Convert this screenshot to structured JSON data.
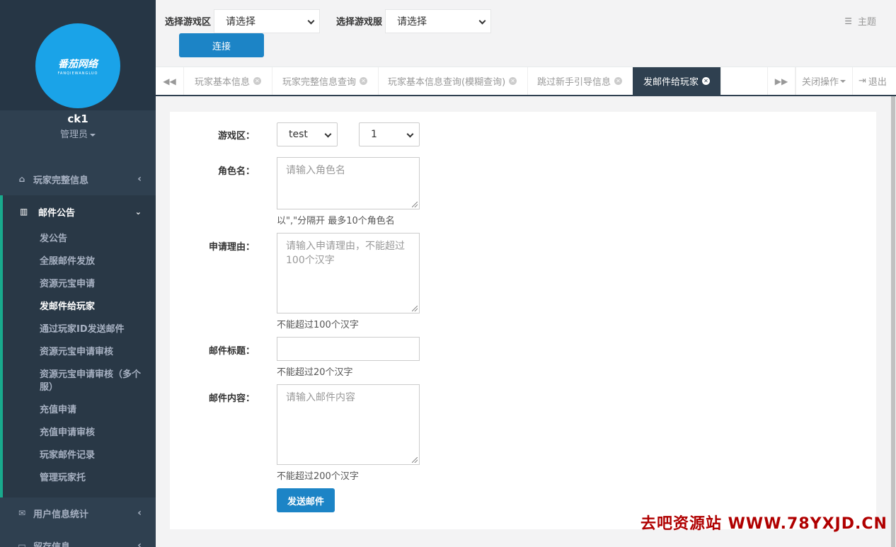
{
  "sidebar": {
    "logo_text": "番茄网络",
    "logo_sub": "FANQIEWANGLUO",
    "username": "ck1",
    "role": "管理员",
    "menu": [
      {
        "label": "玩家完整信息",
        "icon": "home-icon"
      },
      {
        "label": "邮件公告",
        "icon": "bar-chart-icon"
      },
      {
        "label": "用户信息统计",
        "icon": "envelope-icon"
      },
      {
        "label": "留存信息",
        "icon": "monitor-icon"
      }
    ],
    "submenu": [
      "发公告",
      "全服邮件发放",
      "资源元宝申请",
      "发邮件给玩家",
      "通过玩家ID发送邮件",
      "资源元宝申请审核",
      "资源元宝申请审核（多个服）",
      "充值申请",
      "充值申请审核",
      "玩家邮件记录",
      "管理玩家托"
    ]
  },
  "topbar": {
    "zone_label": "选择游戏区",
    "zone_value": "请选择",
    "server_label": "选择游戏服",
    "server_value": "请选择",
    "connect_label": "连接",
    "theme_label": "主题"
  },
  "tabs": {
    "items": [
      "玩家基本信息",
      "玩家完整信息查询",
      "玩家基本信息查询(模糊查询)",
      "跳过新手引导信息",
      "发邮件给玩家"
    ],
    "active_index": 4,
    "close_ops": "关闭操作",
    "logout": "退出"
  },
  "form": {
    "zone_label": "游戏区：",
    "zone_value": "test",
    "server_value": "1",
    "role_label": "角色名：",
    "role_placeholder": "请输入角色名",
    "role_help": "以\",\"分隔开 最多10个角色名",
    "reason_label": "申请理由：",
    "reason_placeholder": "请输入申请理由，不能超过100个汉字",
    "reason_help": "不能超过100个汉字",
    "title_label": "邮件标题：",
    "title_help": "不能超过20个汉字",
    "content_label": "邮件内容：",
    "content_placeholder": "请输入邮件内容",
    "content_help": "不能超过200个汉字",
    "submit_label": "发送邮件"
  },
  "watermark": "去吧资源站 WWW.78YXJD.CN",
  "colors": {
    "sidebar": "#2f4050",
    "accent": "#1c84c6",
    "active_border": "#19aa8d",
    "avatar": "#1aa3e8",
    "watermark": "#b00000"
  }
}
